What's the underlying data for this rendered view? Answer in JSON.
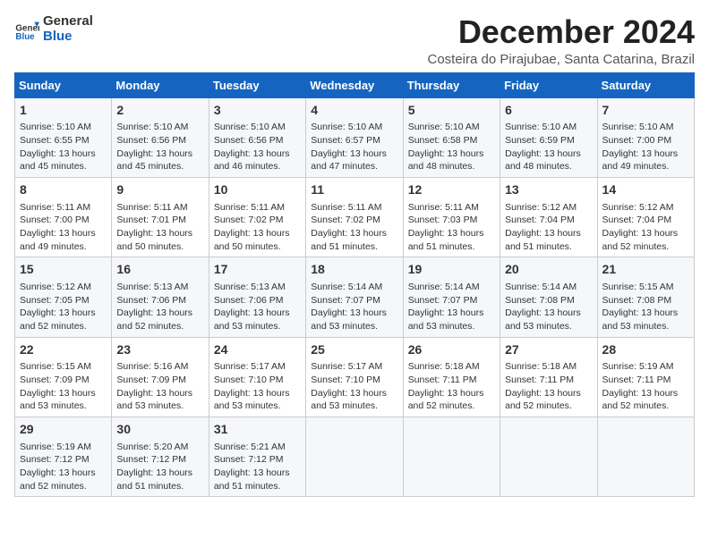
{
  "logo": {
    "line1": "General",
    "line2": "Blue"
  },
  "title": "December 2024",
  "subtitle": "Costeira do Pirajubae, Santa Catarina, Brazil",
  "header_row": [
    "Sunday",
    "Monday",
    "Tuesday",
    "Wednesday",
    "Thursday",
    "Friday",
    "Saturday"
  ],
  "weeks": [
    [
      {
        "day": "1",
        "info": "Sunrise: 5:10 AM\nSunset: 6:55 PM\nDaylight: 13 hours\nand 45 minutes."
      },
      {
        "day": "2",
        "info": "Sunrise: 5:10 AM\nSunset: 6:56 PM\nDaylight: 13 hours\nand 45 minutes."
      },
      {
        "day": "3",
        "info": "Sunrise: 5:10 AM\nSunset: 6:56 PM\nDaylight: 13 hours\nand 46 minutes."
      },
      {
        "day": "4",
        "info": "Sunrise: 5:10 AM\nSunset: 6:57 PM\nDaylight: 13 hours\nand 47 minutes."
      },
      {
        "day": "5",
        "info": "Sunrise: 5:10 AM\nSunset: 6:58 PM\nDaylight: 13 hours\nand 48 minutes."
      },
      {
        "day": "6",
        "info": "Sunrise: 5:10 AM\nSunset: 6:59 PM\nDaylight: 13 hours\nand 48 minutes."
      },
      {
        "day": "7",
        "info": "Sunrise: 5:10 AM\nSunset: 7:00 PM\nDaylight: 13 hours\nand 49 minutes."
      }
    ],
    [
      {
        "day": "8",
        "info": "Sunrise: 5:11 AM\nSunset: 7:00 PM\nDaylight: 13 hours\nand 49 minutes."
      },
      {
        "day": "9",
        "info": "Sunrise: 5:11 AM\nSunset: 7:01 PM\nDaylight: 13 hours\nand 50 minutes."
      },
      {
        "day": "10",
        "info": "Sunrise: 5:11 AM\nSunset: 7:02 PM\nDaylight: 13 hours\nand 50 minutes."
      },
      {
        "day": "11",
        "info": "Sunrise: 5:11 AM\nSunset: 7:02 PM\nDaylight: 13 hours\nand 51 minutes."
      },
      {
        "day": "12",
        "info": "Sunrise: 5:11 AM\nSunset: 7:03 PM\nDaylight: 13 hours\nand 51 minutes."
      },
      {
        "day": "13",
        "info": "Sunrise: 5:12 AM\nSunset: 7:04 PM\nDaylight: 13 hours\nand 51 minutes."
      },
      {
        "day": "14",
        "info": "Sunrise: 5:12 AM\nSunset: 7:04 PM\nDaylight: 13 hours\nand 52 minutes."
      }
    ],
    [
      {
        "day": "15",
        "info": "Sunrise: 5:12 AM\nSunset: 7:05 PM\nDaylight: 13 hours\nand 52 minutes."
      },
      {
        "day": "16",
        "info": "Sunrise: 5:13 AM\nSunset: 7:06 PM\nDaylight: 13 hours\nand 52 minutes."
      },
      {
        "day": "17",
        "info": "Sunrise: 5:13 AM\nSunset: 7:06 PM\nDaylight: 13 hours\nand 53 minutes."
      },
      {
        "day": "18",
        "info": "Sunrise: 5:14 AM\nSunset: 7:07 PM\nDaylight: 13 hours\nand 53 minutes."
      },
      {
        "day": "19",
        "info": "Sunrise: 5:14 AM\nSunset: 7:07 PM\nDaylight: 13 hours\nand 53 minutes."
      },
      {
        "day": "20",
        "info": "Sunrise: 5:14 AM\nSunset: 7:08 PM\nDaylight: 13 hours\nand 53 minutes."
      },
      {
        "day": "21",
        "info": "Sunrise: 5:15 AM\nSunset: 7:08 PM\nDaylight: 13 hours\nand 53 minutes."
      }
    ],
    [
      {
        "day": "22",
        "info": "Sunrise: 5:15 AM\nSunset: 7:09 PM\nDaylight: 13 hours\nand 53 minutes."
      },
      {
        "day": "23",
        "info": "Sunrise: 5:16 AM\nSunset: 7:09 PM\nDaylight: 13 hours\nand 53 minutes."
      },
      {
        "day": "24",
        "info": "Sunrise: 5:17 AM\nSunset: 7:10 PM\nDaylight: 13 hours\nand 53 minutes."
      },
      {
        "day": "25",
        "info": "Sunrise: 5:17 AM\nSunset: 7:10 PM\nDaylight: 13 hours\nand 53 minutes."
      },
      {
        "day": "26",
        "info": "Sunrise: 5:18 AM\nSunset: 7:11 PM\nDaylight: 13 hours\nand 52 minutes."
      },
      {
        "day": "27",
        "info": "Sunrise: 5:18 AM\nSunset: 7:11 PM\nDaylight: 13 hours\nand 52 minutes."
      },
      {
        "day": "28",
        "info": "Sunrise: 5:19 AM\nSunset: 7:11 PM\nDaylight: 13 hours\nand 52 minutes."
      }
    ],
    [
      {
        "day": "29",
        "info": "Sunrise: 5:19 AM\nSunset: 7:12 PM\nDaylight: 13 hours\nand 52 minutes."
      },
      {
        "day": "30",
        "info": "Sunrise: 5:20 AM\nSunset: 7:12 PM\nDaylight: 13 hours\nand 51 minutes."
      },
      {
        "day": "31",
        "info": "Sunrise: 5:21 AM\nSunset: 7:12 PM\nDaylight: 13 hours\nand 51 minutes."
      },
      {
        "day": "",
        "info": ""
      },
      {
        "day": "",
        "info": ""
      },
      {
        "day": "",
        "info": ""
      },
      {
        "day": "",
        "info": ""
      }
    ]
  ]
}
